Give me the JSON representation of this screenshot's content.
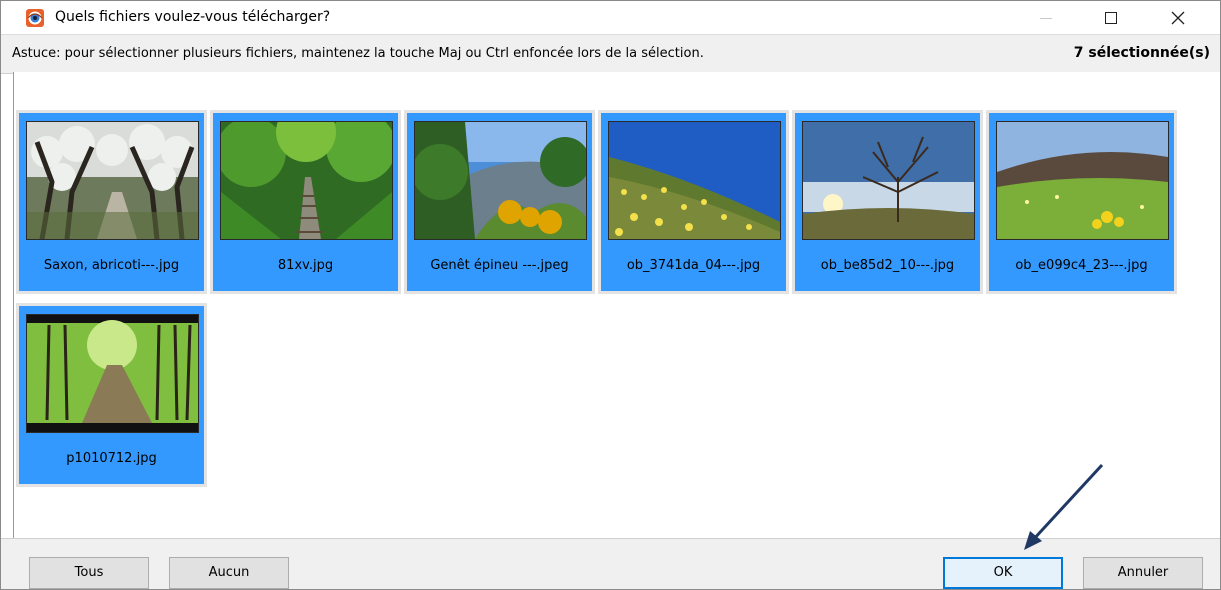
{
  "window": {
    "title": "Quels fichiers voulez-vous télécharger?",
    "controls": {
      "minimize": "minimize-icon",
      "maximize": "maximize-icon",
      "close": "close-icon"
    }
  },
  "hint": {
    "text": "Astuce: pour sélectionner plusieurs fichiers, maintenez la touche Maj ou Ctrl enfoncée lors de la sélection.",
    "selected_count": "7 sélectionnée(s)"
  },
  "files": [
    {
      "name": "Saxon, abricoti---.jpg",
      "selected": true,
      "thumbnail": "blossom-orchard-path"
    },
    {
      "name": "81xv.jpg",
      "selected": true,
      "thumbnail": "green-tunnel-railway"
    },
    {
      "name": "Genêt épineu ---.jpeg",
      "selected": true,
      "thumbnail": "broom-shrubs-mountain"
    },
    {
      "name": "ob_3741da_04---.jpg",
      "selected": true,
      "thumbnail": "daffodil-hillside"
    },
    {
      "name": "ob_be85d2_10---.jpg",
      "selected": true,
      "thumbnail": "tree-at-sunset"
    },
    {
      "name": "ob_e099c4_23---.jpg",
      "selected": true,
      "thumbnail": "meadow-flowers"
    },
    {
      "name": "p1010712.jpg",
      "selected": true,
      "thumbnail": "forest-road"
    }
  ],
  "buttons": {
    "all": "Tous",
    "none": "Aucun",
    "ok": "OK",
    "cancel": "Annuler"
  },
  "colors": {
    "selection": "#3399ff",
    "default_button_border": "#0078d7",
    "annotation_arrow": "#1f3864"
  }
}
